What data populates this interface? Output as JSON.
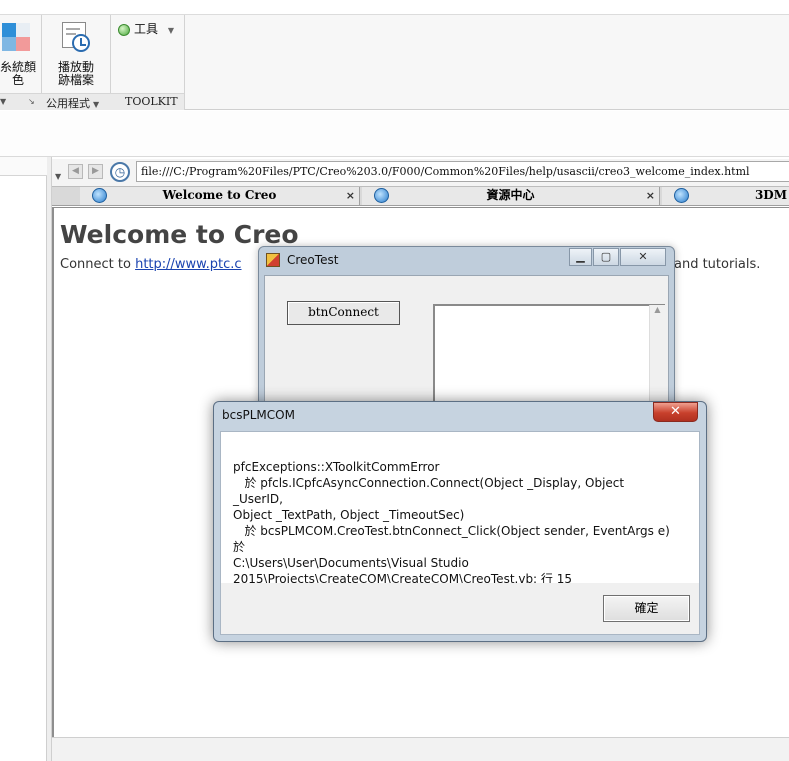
{
  "ribbon": {
    "color_button_label": "糸統顏\n色",
    "playback_button_label": "播放動\n跡檔案",
    "tools_button_label": "工具",
    "groups": {
      "utilities": "公用程式",
      "toolkit": "TOOLKIT"
    }
  },
  "browser": {
    "url": "file:///C:/Program%20Files/PTC/Creo%203.0/F000/Common%20Files/help/usascii/creo3_welcome_index.html",
    "tabs": [
      {
        "label": "Welcome to Creo"
      },
      {
        "label": "資源中心"
      },
      {
        "label": "3DM"
      }
    ],
    "tab_close_glyph": "×",
    "page": {
      "heading": "Welcome to Creo",
      "line_prefix": "Connect to ",
      "link_text": "http://www.ptc.c",
      "line_suffix": "and tutorials."
    }
  },
  "creotest_window": {
    "title": "CreoTest",
    "connect_button_label": "btnConnect"
  },
  "message_box": {
    "title": "bcsPLMCOM",
    "message": "pfcExceptions::XToolkitCommError\n   於 pfcls.ICpfcAsyncConnection.Connect(Object _Display, Object _UserID,\nObject _TextPath, Object _TimeoutSec)\n   於 bcsPLMCOM.CreoTest.btnConnect_Click(Object sender, EventArgs e) 於\nC:\\Users\\User\\Documents\\Visual Studio\n2015\\Projects\\CreateCOM\\CreateCOM\\CreoTest.vb: 行 15",
    "ok_label": "確定",
    "close_glyph": "✕"
  },
  "colors": {
    "link": "#1a43b0",
    "close_button": "#c8402c",
    "window_frame": "#bfcddb"
  },
  "icons": [
    "color-scheme-icon",
    "playback-trail-icon",
    "tools-icon",
    "back-arrow-icon",
    "forward-arrow-icon",
    "history-icon",
    "ie-page-icon",
    "app-icon",
    "minimize-icon",
    "maximize-icon",
    "close-icon"
  ]
}
